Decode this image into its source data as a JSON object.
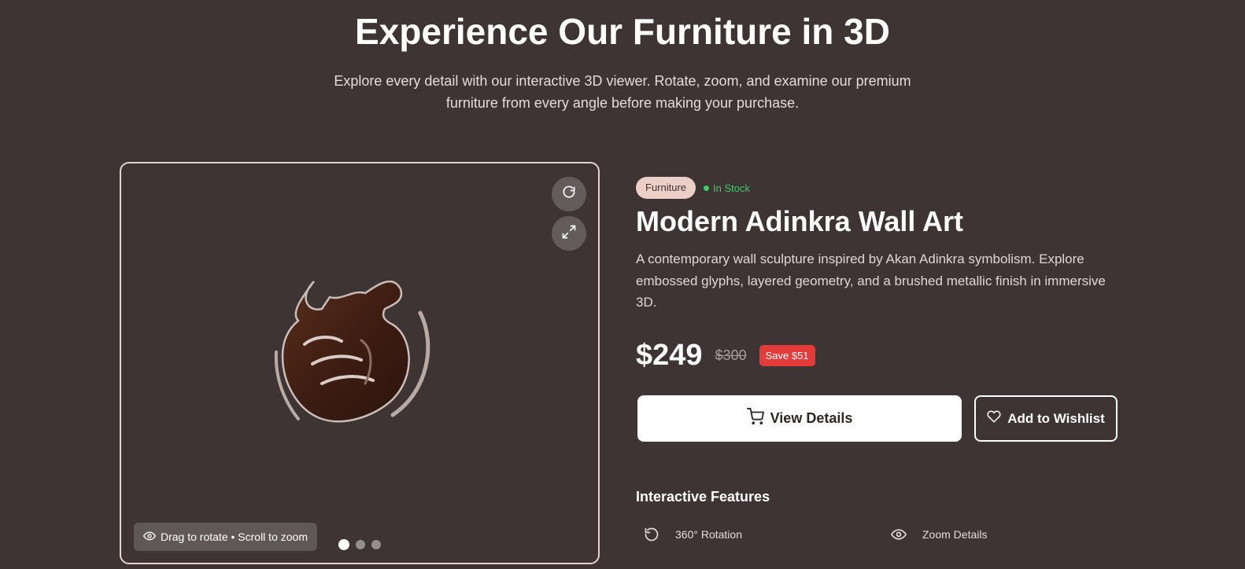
{
  "hero": {
    "title": "Experience Our Furniture in 3D",
    "subtitle": "Explore every detail with our interactive 3D viewer. Rotate, zoom, and examine our premium furniture from every angle before making your purchase."
  },
  "viewer": {
    "hint": "Drag to rotate • Scroll to zoom",
    "controls": [
      {
        "icon": "rotate-icon"
      },
      {
        "icon": "expand-icon"
      }
    ],
    "pagination_count": 3,
    "active_index": 0
  },
  "product": {
    "category": "Furniture",
    "stock_status": "In Stock",
    "title": "Modern Adinkra Wall Art",
    "description": "A contemporary wall sculpture inspired by Akan Adinkra symbolism. Explore embossed glyphs, layered geometry, and a brushed metallic finish in immersive 3D.",
    "price": "$249",
    "old_price": "$300",
    "save_badge": "Save $51"
  },
  "actions": {
    "primary_label": "View Details",
    "secondary_label": "Add to Wishlist"
  },
  "features": {
    "title": "Interactive Features",
    "items": [
      {
        "label": "360° Rotation",
        "icon": "rotation-icon"
      },
      {
        "label": "Zoom Details",
        "icon": "eye-icon"
      }
    ]
  },
  "colors": {
    "background": "#3d3433",
    "accent_pill": "#ecd0c8",
    "in_stock": "#3fc86a",
    "sale_badge": "#e53a3a"
  }
}
